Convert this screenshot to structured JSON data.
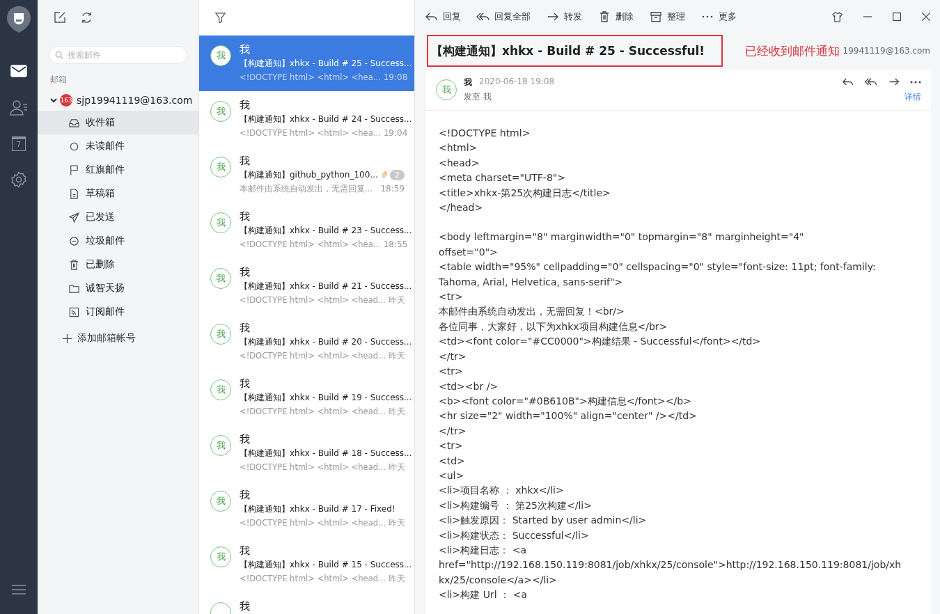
{
  "rail": {
    "items": [
      {
        "kind": "mail",
        "selected": true
      },
      {
        "kind": "contacts",
        "selected": false
      },
      {
        "kind": "calendar",
        "selected": false,
        "day": "7"
      },
      {
        "kind": "settings",
        "selected": false
      }
    ]
  },
  "folders_panel": {
    "search": {
      "placeholder": "搜索邮件"
    },
    "section_label": "邮箱",
    "account": {
      "badge": "163",
      "address": "sjp19941119@163.com",
      "expanded": true
    },
    "folders": [
      {
        "kind": "inbox",
        "label": "收件箱",
        "selected": true
      },
      {
        "kind": "unread",
        "label": "未读邮件",
        "selected": false
      },
      {
        "kind": "flag",
        "label": "红旗邮件",
        "selected": false
      },
      {
        "kind": "draft",
        "label": "草稿箱",
        "selected": false
      },
      {
        "kind": "sent",
        "label": "已发送",
        "selected": false
      },
      {
        "kind": "spam",
        "label": "垃圾邮件",
        "selected": false
      },
      {
        "kind": "trash",
        "label": "已删除",
        "selected": false
      },
      {
        "kind": "folder",
        "label": "诚智天扬",
        "selected": false
      },
      {
        "kind": "rss",
        "label": "订阅邮件",
        "selected": false
      }
    ],
    "add_account": "添加邮箱帐号"
  },
  "message_list": [
    {
      "avatar": "我",
      "sender": "我",
      "subject": "【构建通知】xhkx - Build # 25 - Success...",
      "preview": "<!DOCTYPE html> <html> <hea...",
      "time": "19:08",
      "selected": true
    },
    {
      "avatar": "我",
      "sender": "我",
      "subject": "【构建通知】xhkx - Build # 24 - Success...",
      "preview": "<!DOCTYPE html> <html> <hea...",
      "time": "19:04",
      "selected": false
    },
    {
      "avatar": "我",
      "sender": "我",
      "subject": "【构建通知】github_python_100...",
      "attachment": true,
      "count": "2",
      "preview": "本邮件由系统自动发出，无需回复...",
      "time": "18:59",
      "selected": false
    },
    {
      "avatar": "我",
      "sender": "我",
      "subject": "【构建通知】xhkx - Build # 23 - Success...",
      "preview": "<!DOCTYPE html> <html> <hea...",
      "time": "18:55",
      "selected": false
    },
    {
      "avatar": "我",
      "sender": "我",
      "subject": "【构建通知】xhkx - Build # 21 - Success...",
      "preview": "<!DOCTYPE html> <html> <head...",
      "time": "昨天",
      "selected": false
    },
    {
      "avatar": "我",
      "sender": "我",
      "subject": "【构建通知】xhkx - Build # 20 - Success...",
      "preview": "<!DOCTYPE html> <html> <head...",
      "time": "昨天",
      "selected": false
    },
    {
      "avatar": "我",
      "sender": "我",
      "subject": "【构建通知】xhkx - Build # 19 - Success...",
      "preview": "<!DOCTYPE html> <html> <head...",
      "time": "昨天",
      "selected": false
    },
    {
      "avatar": "我",
      "sender": "我",
      "subject": "【构建通知】xhkx - Build # 18 - Success...",
      "preview": "<!DOCTYPE html> <html> <head...",
      "time": "昨天",
      "selected": false
    },
    {
      "avatar": "我",
      "sender": "我",
      "subject": "【构建通知】xhkx - Build # 17 - Fixed!",
      "preview": "<!DOCTYPE html> <html> <head...",
      "time": "昨天",
      "selected": false
    },
    {
      "avatar": "我",
      "sender": "我",
      "subject": "【构建通知】xhkx - Build # 15 - Success...",
      "preview": "<!DOCTYPE html> <html> <head...",
      "time": "昨天",
      "selected": false
    },
    {
      "sender": "我",
      "selected": false
    }
  ],
  "toolbar": [
    {
      "kind": "reply",
      "label": "回复"
    },
    {
      "kind": "reply_all",
      "label": "回复全部"
    },
    {
      "kind": "forward",
      "label": "转发"
    },
    {
      "kind": "delete",
      "label": "删除"
    },
    {
      "kind": "organize",
      "label": "整理"
    },
    {
      "kind": "more",
      "label": "更多"
    }
  ],
  "message": {
    "subject": "【构建通知】xhkx - Build # 25 - Successful!",
    "annotation": "已经收到邮件通知",
    "account_address": "19941119@163.com",
    "avatar": "我",
    "sender": "我",
    "date": "2020-06-18 19:08",
    "to_label": "发至",
    "to": "我",
    "details_link": "详情",
    "body": [
      [
        "<!DOCTYPE html>",
        "<html>",
        "<head>",
        "<meta charset=\"UTF-8\">",
        "<title>xhkx-第25次构建日志</title>",
        "</head>"
      ],
      [
        "<body leftmargin=\"8\" marginwidth=\"0\" topmargin=\"8\" marginheight=\"4\"",
        "offset=\"0\">",
        "<table width=\"95%\" cellpadding=\"0\" cellspacing=\"0\"  style=\"font-size: 11pt; font-family:",
        "Tahoma, Arial, Helvetica, sans-serif\">",
        "<tr>",
        "本邮件由系统自动发出，无需回复！<br/>",
        "各位同事，大家好，以下为xhkx项目构建信息</br>",
        "<td><font color=\"#CC0000\">构建结果 - Successful</font></td>",
        "</tr>",
        "<tr>",
        "<td><br />",
        "<b><font color=\"#0B610B\">构建信息</font></b>",
        "<hr size=\"2\" width=\"100%\" align=\"center\" /></td>",
        "</tr>",
        "<tr>",
        "<td>",
        "<ul>",
        "<li>项目名称 ： xhkx</li>",
        "<li>构建编号 ： 第25次构建</li>",
        "<li>触发原因： Started by user admin</li>",
        "<li>构建状态： Successful</li>",
        "<li>构建日志： <a",
        "href=\"http://192.168.150.119:8081/job/xhkx/25/console\">http://192.168.150.119:8081/job/xh",
        "kx/25/console</a></li>",
        "<li>构建  Url ： <a"
      ]
    ]
  }
}
